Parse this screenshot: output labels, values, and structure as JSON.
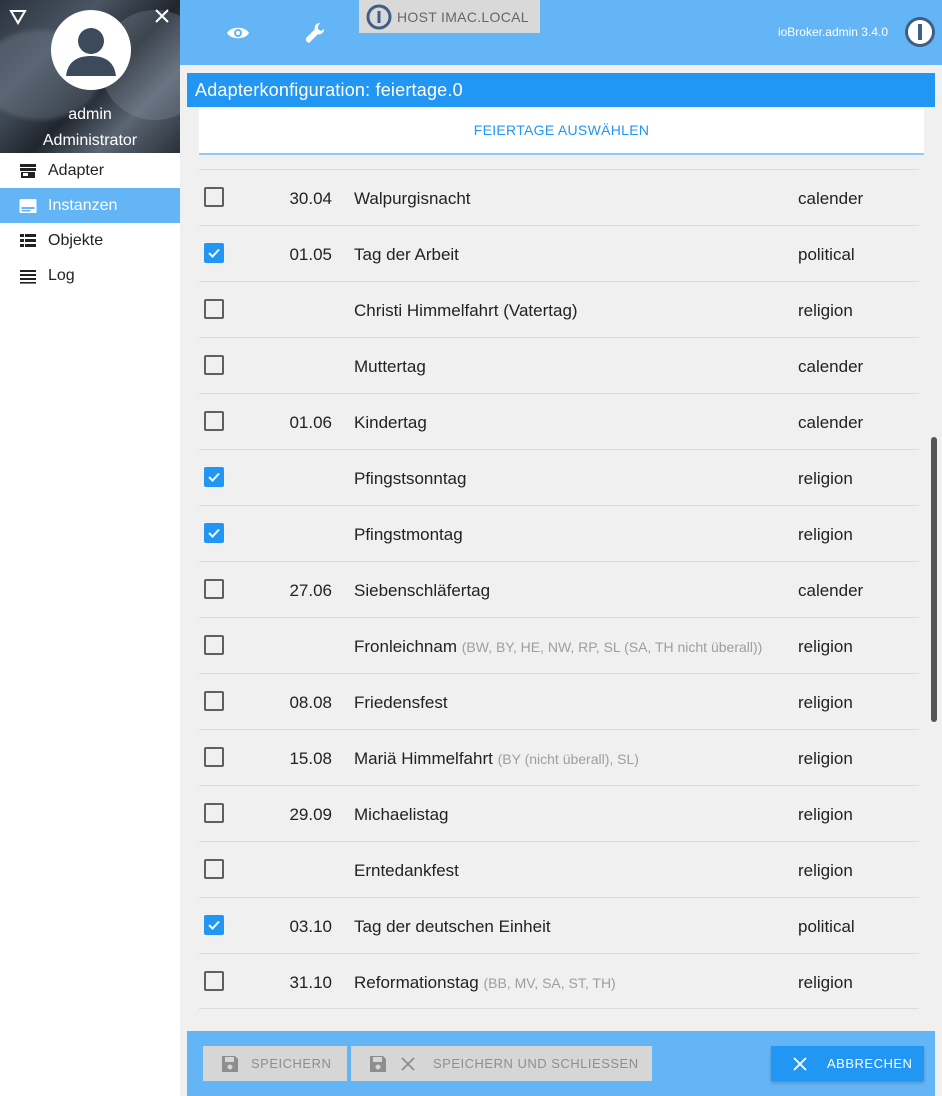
{
  "user": {
    "name": "admin",
    "role": "Administrator"
  },
  "nav": [
    {
      "label": "Adapter",
      "icon": "store-icon",
      "active": false
    },
    {
      "label": "Instanzen",
      "icon": "instances-icon",
      "active": true
    },
    {
      "label": "Objekte",
      "icon": "list-view-icon",
      "active": false
    },
    {
      "label": "Log",
      "icon": "log-lines-icon",
      "active": false
    }
  ],
  "header": {
    "host_label": "HOST IMAC.LOCAL",
    "version": "ioBroker.admin 3.4.0"
  },
  "panel": {
    "title": "Adapterkonfiguration: feiertage.0",
    "tab_label": "FEIERTAGE AUSWÄHLEN"
  },
  "holidays": [
    {
      "checked": false,
      "date": "30.04",
      "name": "Walpurgisnacht",
      "note": "",
      "type": "calender"
    },
    {
      "checked": true,
      "date": "01.05",
      "name": "Tag der Arbeit",
      "note": "",
      "type": "political"
    },
    {
      "checked": false,
      "date": "",
      "name": "Christi Himmelfahrt (Vatertag)",
      "note": "",
      "type": "religion"
    },
    {
      "checked": false,
      "date": "",
      "name": "Muttertag",
      "note": "",
      "type": "calender"
    },
    {
      "checked": false,
      "date": "01.06",
      "name": "Kindertag",
      "note": "",
      "type": "calender"
    },
    {
      "checked": true,
      "date": "",
      "name": "Pfingstsonntag",
      "note": "",
      "type": "religion"
    },
    {
      "checked": true,
      "date": "",
      "name": "Pfingstmontag",
      "note": "",
      "type": "religion"
    },
    {
      "checked": false,
      "date": "27.06",
      "name": "Siebenschläfertag",
      "note": "",
      "type": "calender"
    },
    {
      "checked": false,
      "date": "",
      "name": "Fronleichnam",
      "note": "(BW, BY, HE, NW, RP, SL (SA, TH nicht überall))",
      "type": "religion"
    },
    {
      "checked": false,
      "date": "08.08",
      "name": "Friedensfest",
      "note": "",
      "type": "religion"
    },
    {
      "checked": false,
      "date": "15.08",
      "name": "Mariä Himmelfahrt",
      "note": "(BY (nicht überall), SL)",
      "type": "religion"
    },
    {
      "checked": false,
      "date": "29.09",
      "name": "Michaelistag",
      "note": "",
      "type": "religion"
    },
    {
      "checked": false,
      "date": "",
      "name": "Erntedankfest",
      "note": "",
      "type": "religion"
    },
    {
      "checked": true,
      "date": "03.10",
      "name": "Tag der deutschen Einheit",
      "note": "",
      "type": "political"
    },
    {
      "checked": false,
      "date": "31.10",
      "name": "Reformationstag",
      "note": "(BB, MV, SA, ST, TH)",
      "type": "religion"
    }
  ],
  "footer": {
    "save_label": "SPEICHERN",
    "save_close_label": "SPEICHERN UND SCHLIESSEN",
    "cancel_label": "ABBRECHEN"
  },
  "colors": {
    "accent": "#2196f3",
    "header": "#64b5f6",
    "active_nav": "#64b5f6",
    "button_disabled": "#d6d6d6"
  }
}
